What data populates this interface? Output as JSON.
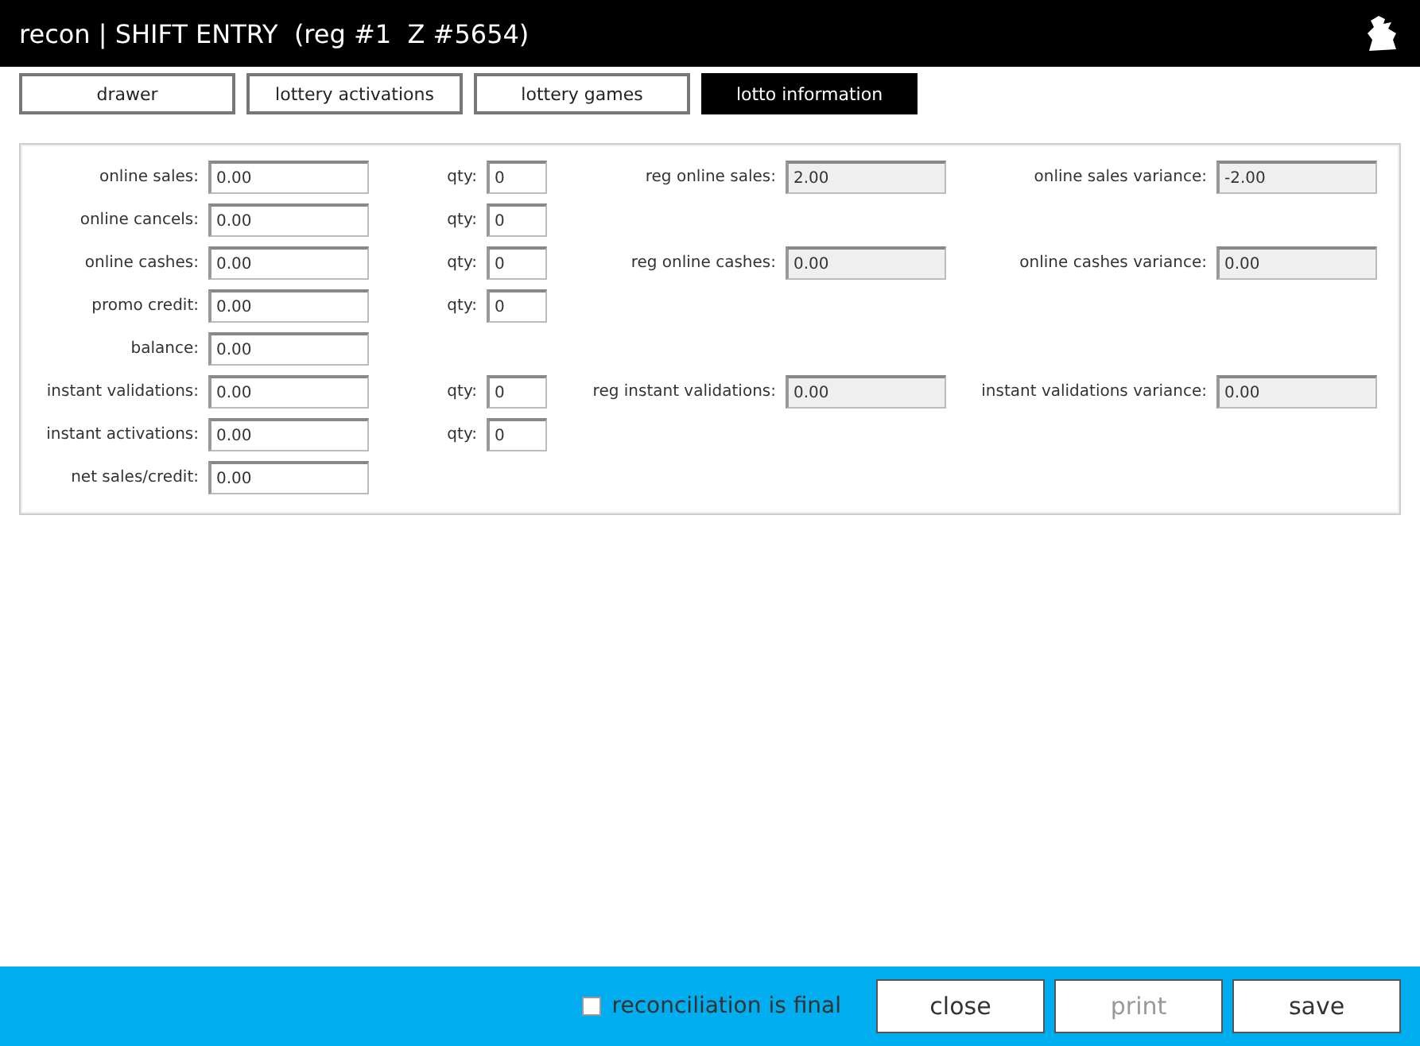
{
  "window": {
    "title": "recon | SHIFT ENTRY  (reg #1  Z #5654)"
  },
  "tabs": [
    {
      "label": "drawer",
      "selected": false
    },
    {
      "label": "lottery activations",
      "selected": false
    },
    {
      "label": "lottery games",
      "selected": false
    },
    {
      "label": "lotto information",
      "selected": true
    }
  ],
  "rows": [
    {
      "label": "online sales:",
      "value": "0.00",
      "qty": {
        "label": "qty:",
        "value": "0"
      },
      "reg": {
        "label": "reg online sales:",
        "value": "2.00"
      },
      "variance": {
        "label": "online sales variance:",
        "value": "-2.00"
      }
    },
    {
      "label": "online cancels:",
      "value": "0.00",
      "qty": {
        "label": "qty:",
        "value": "0"
      }
    },
    {
      "label": "online cashes:",
      "value": "0.00",
      "qty": {
        "label": "qty:",
        "value": "0"
      },
      "reg": {
        "label": "reg online cashes:",
        "value": "0.00"
      },
      "variance": {
        "label": "online cashes variance:",
        "value": "0.00"
      }
    },
    {
      "label": "promo credit:",
      "value": "0.00",
      "qty": {
        "label": "qty:",
        "value": "0"
      }
    },
    {
      "label": "balance:",
      "value": "0.00"
    },
    {
      "label": "instant validations:",
      "value": "0.00",
      "qty": {
        "label": "qty:",
        "value": "0"
      },
      "reg": {
        "label": "reg instant validations:",
        "value": "0.00"
      },
      "variance": {
        "label": "instant validations variance:",
        "value": "0.00"
      }
    },
    {
      "label": "instant activations:",
      "value": "0.00",
      "qty": {
        "label": "qty:",
        "value": "0"
      }
    },
    {
      "label": "net sales/credit:",
      "value": "0.00"
    }
  ],
  "footer": {
    "final": {
      "label": "reconciliation is final",
      "checked": false
    },
    "buttons": [
      {
        "label": "close",
        "disabled": false
      },
      {
        "label": "print",
        "disabled": true
      },
      {
        "label": "save",
        "disabled": false
      }
    ]
  }
}
